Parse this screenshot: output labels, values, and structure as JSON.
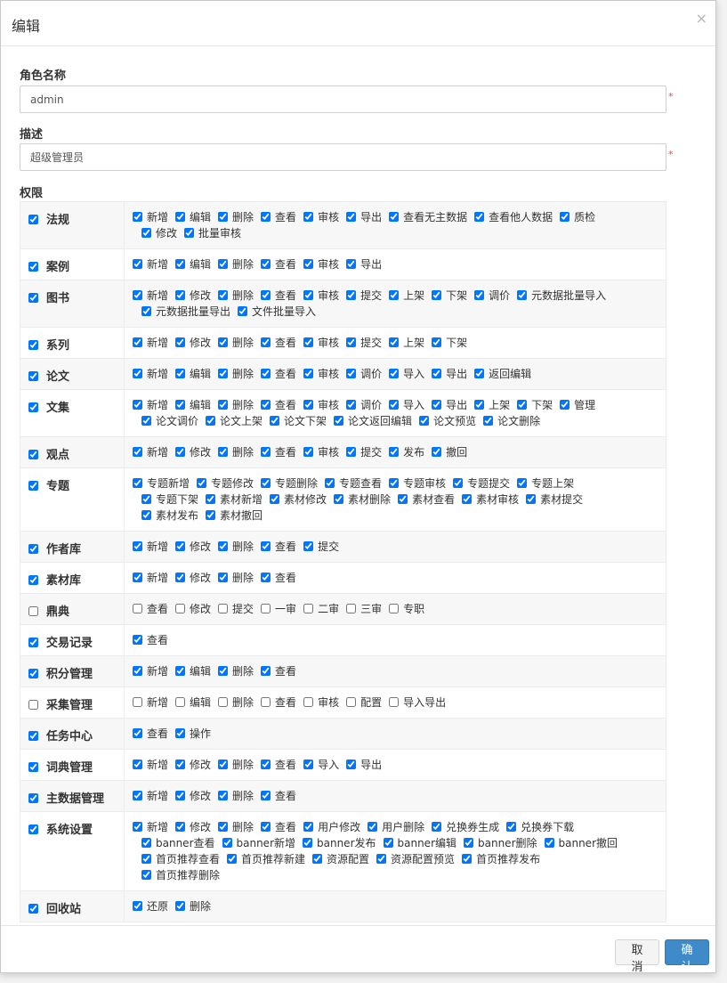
{
  "dialog": {
    "title": "编辑",
    "close_glyph": "×",
    "role_name_label": "角色名称",
    "role_name_value": "admin",
    "description_label": "描述",
    "description_value": "超级管理员",
    "required_mark": "*",
    "permissions_label": "权限",
    "cancel_label": "取消",
    "confirm_label": "确认"
  },
  "permissions": [
    {
      "module": "法规",
      "checked": true,
      "actions": [
        {
          "label": "新增",
          "checked": true
        },
        {
          "label": "编辑",
          "checked": true
        },
        {
          "label": "删除",
          "checked": true
        },
        {
          "label": "查看",
          "checked": true
        },
        {
          "label": "审核",
          "checked": true
        },
        {
          "label": "导出",
          "checked": true
        },
        {
          "label": "查看无主数据",
          "checked": true
        },
        {
          "label": "查看他人数据",
          "checked": true
        },
        {
          "label": "质检",
          "checked": true
        },
        {
          "label": "修改",
          "checked": true
        },
        {
          "label": "批量审核",
          "checked": true
        }
      ]
    },
    {
      "module": "案例",
      "checked": true,
      "actions": [
        {
          "label": "新增",
          "checked": true
        },
        {
          "label": "编辑",
          "checked": true
        },
        {
          "label": "删除",
          "checked": true
        },
        {
          "label": "查看",
          "checked": true
        },
        {
          "label": "审核",
          "checked": true
        },
        {
          "label": "导出",
          "checked": true
        }
      ]
    },
    {
      "module": "图书",
      "checked": true,
      "actions": [
        {
          "label": "新增",
          "checked": true
        },
        {
          "label": "修改",
          "checked": true
        },
        {
          "label": "删除",
          "checked": true
        },
        {
          "label": "查看",
          "checked": true
        },
        {
          "label": "审核",
          "checked": true
        },
        {
          "label": "提交",
          "checked": true
        },
        {
          "label": "上架",
          "checked": true
        },
        {
          "label": "下架",
          "checked": true
        },
        {
          "label": "调价",
          "checked": true
        },
        {
          "label": "元数据批量导入",
          "checked": true
        },
        {
          "label": "元数据批量导出",
          "checked": true
        },
        {
          "label": "文件批量导入",
          "checked": true
        }
      ]
    },
    {
      "module": "系列",
      "checked": true,
      "actions": [
        {
          "label": "新增",
          "checked": true
        },
        {
          "label": "修改",
          "checked": true
        },
        {
          "label": "删除",
          "checked": true
        },
        {
          "label": "查看",
          "checked": true
        },
        {
          "label": "审核",
          "checked": true
        },
        {
          "label": "提交",
          "checked": true
        },
        {
          "label": "上架",
          "checked": true
        },
        {
          "label": "下架",
          "checked": true
        }
      ]
    },
    {
      "module": "论文",
      "checked": true,
      "actions": [
        {
          "label": "新增",
          "checked": true
        },
        {
          "label": "编辑",
          "checked": true
        },
        {
          "label": "删除",
          "checked": true
        },
        {
          "label": "查看",
          "checked": true
        },
        {
          "label": "审核",
          "checked": true
        },
        {
          "label": "调价",
          "checked": true
        },
        {
          "label": "导入",
          "checked": true
        },
        {
          "label": "导出",
          "checked": true
        },
        {
          "label": "返回编辑",
          "checked": true
        }
      ]
    },
    {
      "module": "文集",
      "checked": true,
      "actions": [
        {
          "label": "新增",
          "checked": true
        },
        {
          "label": "编辑",
          "checked": true
        },
        {
          "label": "删除",
          "checked": true
        },
        {
          "label": "查看",
          "checked": true
        },
        {
          "label": "审核",
          "checked": true
        },
        {
          "label": "调价",
          "checked": true
        },
        {
          "label": "导入",
          "checked": true
        },
        {
          "label": "导出",
          "checked": true
        },
        {
          "label": "上架",
          "checked": true
        },
        {
          "label": "下架",
          "checked": true
        },
        {
          "label": "管理",
          "checked": true
        },
        {
          "label": "论文调价",
          "checked": true
        },
        {
          "label": "论文上架",
          "checked": true
        },
        {
          "label": "论文下架",
          "checked": true
        },
        {
          "label": "论文返回编辑",
          "checked": true
        },
        {
          "label": "论文预览",
          "checked": true
        },
        {
          "label": "论文删除",
          "checked": true
        }
      ]
    },
    {
      "module": "观点",
      "checked": true,
      "actions": [
        {
          "label": "新增",
          "checked": true
        },
        {
          "label": "修改",
          "checked": true
        },
        {
          "label": "删除",
          "checked": true
        },
        {
          "label": "查看",
          "checked": true
        },
        {
          "label": "审核",
          "checked": true
        },
        {
          "label": "提交",
          "checked": true
        },
        {
          "label": "发布",
          "checked": true
        },
        {
          "label": "撤回",
          "checked": true
        }
      ]
    },
    {
      "module": "专题",
      "checked": true,
      "actions": [
        {
          "label": "专题新增",
          "checked": true
        },
        {
          "label": "专题修改",
          "checked": true
        },
        {
          "label": "专题删除",
          "checked": true
        },
        {
          "label": "专题查看",
          "checked": true
        },
        {
          "label": "专题审核",
          "checked": true
        },
        {
          "label": "专题提交",
          "checked": true
        },
        {
          "label": "专题上架",
          "checked": true
        },
        {
          "label": "专题下架",
          "checked": true
        },
        {
          "label": "素材新增",
          "checked": true
        },
        {
          "label": "素材修改",
          "checked": true
        },
        {
          "label": "素材删除",
          "checked": true
        },
        {
          "label": "素材查看",
          "checked": true
        },
        {
          "label": "素材审核",
          "checked": true
        },
        {
          "label": "素材提交",
          "checked": true
        },
        {
          "label": "素材发布",
          "checked": true
        },
        {
          "label": "素材撤回",
          "checked": true
        }
      ]
    },
    {
      "module": "作者库",
      "checked": true,
      "actions": [
        {
          "label": "新增",
          "checked": true
        },
        {
          "label": "修改",
          "checked": true
        },
        {
          "label": "删除",
          "checked": true
        },
        {
          "label": "查看",
          "checked": true
        },
        {
          "label": "提交",
          "checked": true
        }
      ]
    },
    {
      "module": "素材库",
      "checked": true,
      "actions": [
        {
          "label": "新增",
          "checked": true
        },
        {
          "label": "修改",
          "checked": true
        },
        {
          "label": "删除",
          "checked": true
        },
        {
          "label": "查看",
          "checked": true
        }
      ]
    },
    {
      "module": "鼎典",
      "checked": false,
      "actions": [
        {
          "label": "查看",
          "checked": false
        },
        {
          "label": "修改",
          "checked": false
        },
        {
          "label": "提交",
          "checked": false
        },
        {
          "label": "一审",
          "checked": false
        },
        {
          "label": "二审",
          "checked": false
        },
        {
          "label": "三审",
          "checked": false
        },
        {
          "label": "专职",
          "checked": false
        }
      ]
    },
    {
      "module": "交易记录",
      "checked": true,
      "actions": [
        {
          "label": "查看",
          "checked": true
        }
      ]
    },
    {
      "module": "积分管理",
      "checked": true,
      "actions": [
        {
          "label": "新增",
          "checked": true
        },
        {
          "label": "编辑",
          "checked": true
        },
        {
          "label": "删除",
          "checked": true
        },
        {
          "label": "查看",
          "checked": true
        }
      ]
    },
    {
      "module": "采集管理",
      "checked": false,
      "actions": [
        {
          "label": "新增",
          "checked": false
        },
        {
          "label": "编辑",
          "checked": false
        },
        {
          "label": "删除",
          "checked": false
        },
        {
          "label": "查看",
          "checked": false
        },
        {
          "label": "审核",
          "checked": false
        },
        {
          "label": "配置",
          "checked": false
        },
        {
          "label": "导入导出",
          "checked": false
        }
      ]
    },
    {
      "module": "任务中心",
      "checked": true,
      "actions": [
        {
          "label": "查看",
          "checked": true
        },
        {
          "label": "操作",
          "checked": true
        }
      ]
    },
    {
      "module": "词典管理",
      "checked": true,
      "actions": [
        {
          "label": "新增",
          "checked": true
        },
        {
          "label": "修改",
          "checked": true
        },
        {
          "label": "删除",
          "checked": true
        },
        {
          "label": "查看",
          "checked": true
        },
        {
          "label": "导入",
          "checked": true
        },
        {
          "label": "导出",
          "checked": true
        }
      ]
    },
    {
      "module": "主数据管理",
      "checked": true,
      "actions": [
        {
          "label": "新增",
          "checked": true
        },
        {
          "label": "修改",
          "checked": true
        },
        {
          "label": "删除",
          "checked": true
        },
        {
          "label": "查看",
          "checked": true
        }
      ]
    },
    {
      "module": "系统设置",
      "checked": true,
      "actions": [
        {
          "label": "新增",
          "checked": true
        },
        {
          "label": "修改",
          "checked": true
        },
        {
          "label": "删除",
          "checked": true
        },
        {
          "label": "查看",
          "checked": true
        },
        {
          "label": "用户修改",
          "checked": true
        },
        {
          "label": "用户删除",
          "checked": true
        },
        {
          "label": "兑换券生成",
          "checked": true
        },
        {
          "label": "兑换券下载",
          "checked": true
        },
        {
          "label": "banner查看",
          "checked": true
        },
        {
          "label": "banner新增",
          "checked": true
        },
        {
          "label": "banner发布",
          "checked": true
        },
        {
          "label": "banner编辑",
          "checked": true
        },
        {
          "label": "banner删除",
          "checked": true
        },
        {
          "label": "banner撤回",
          "checked": true
        },
        {
          "label": "首页推荐查看",
          "checked": true
        },
        {
          "label": "首页推荐新建",
          "checked": true
        },
        {
          "label": "资源配置",
          "checked": true
        },
        {
          "label": "资源配置预览",
          "checked": true
        },
        {
          "label": "首页推荐发布",
          "checked": true
        },
        {
          "label": "首页推荐删除",
          "checked": true
        }
      ]
    },
    {
      "module": "回收站",
      "checked": true,
      "actions": [
        {
          "label": "还原",
          "checked": true
        },
        {
          "label": "删除",
          "checked": true
        }
      ]
    }
  ]
}
